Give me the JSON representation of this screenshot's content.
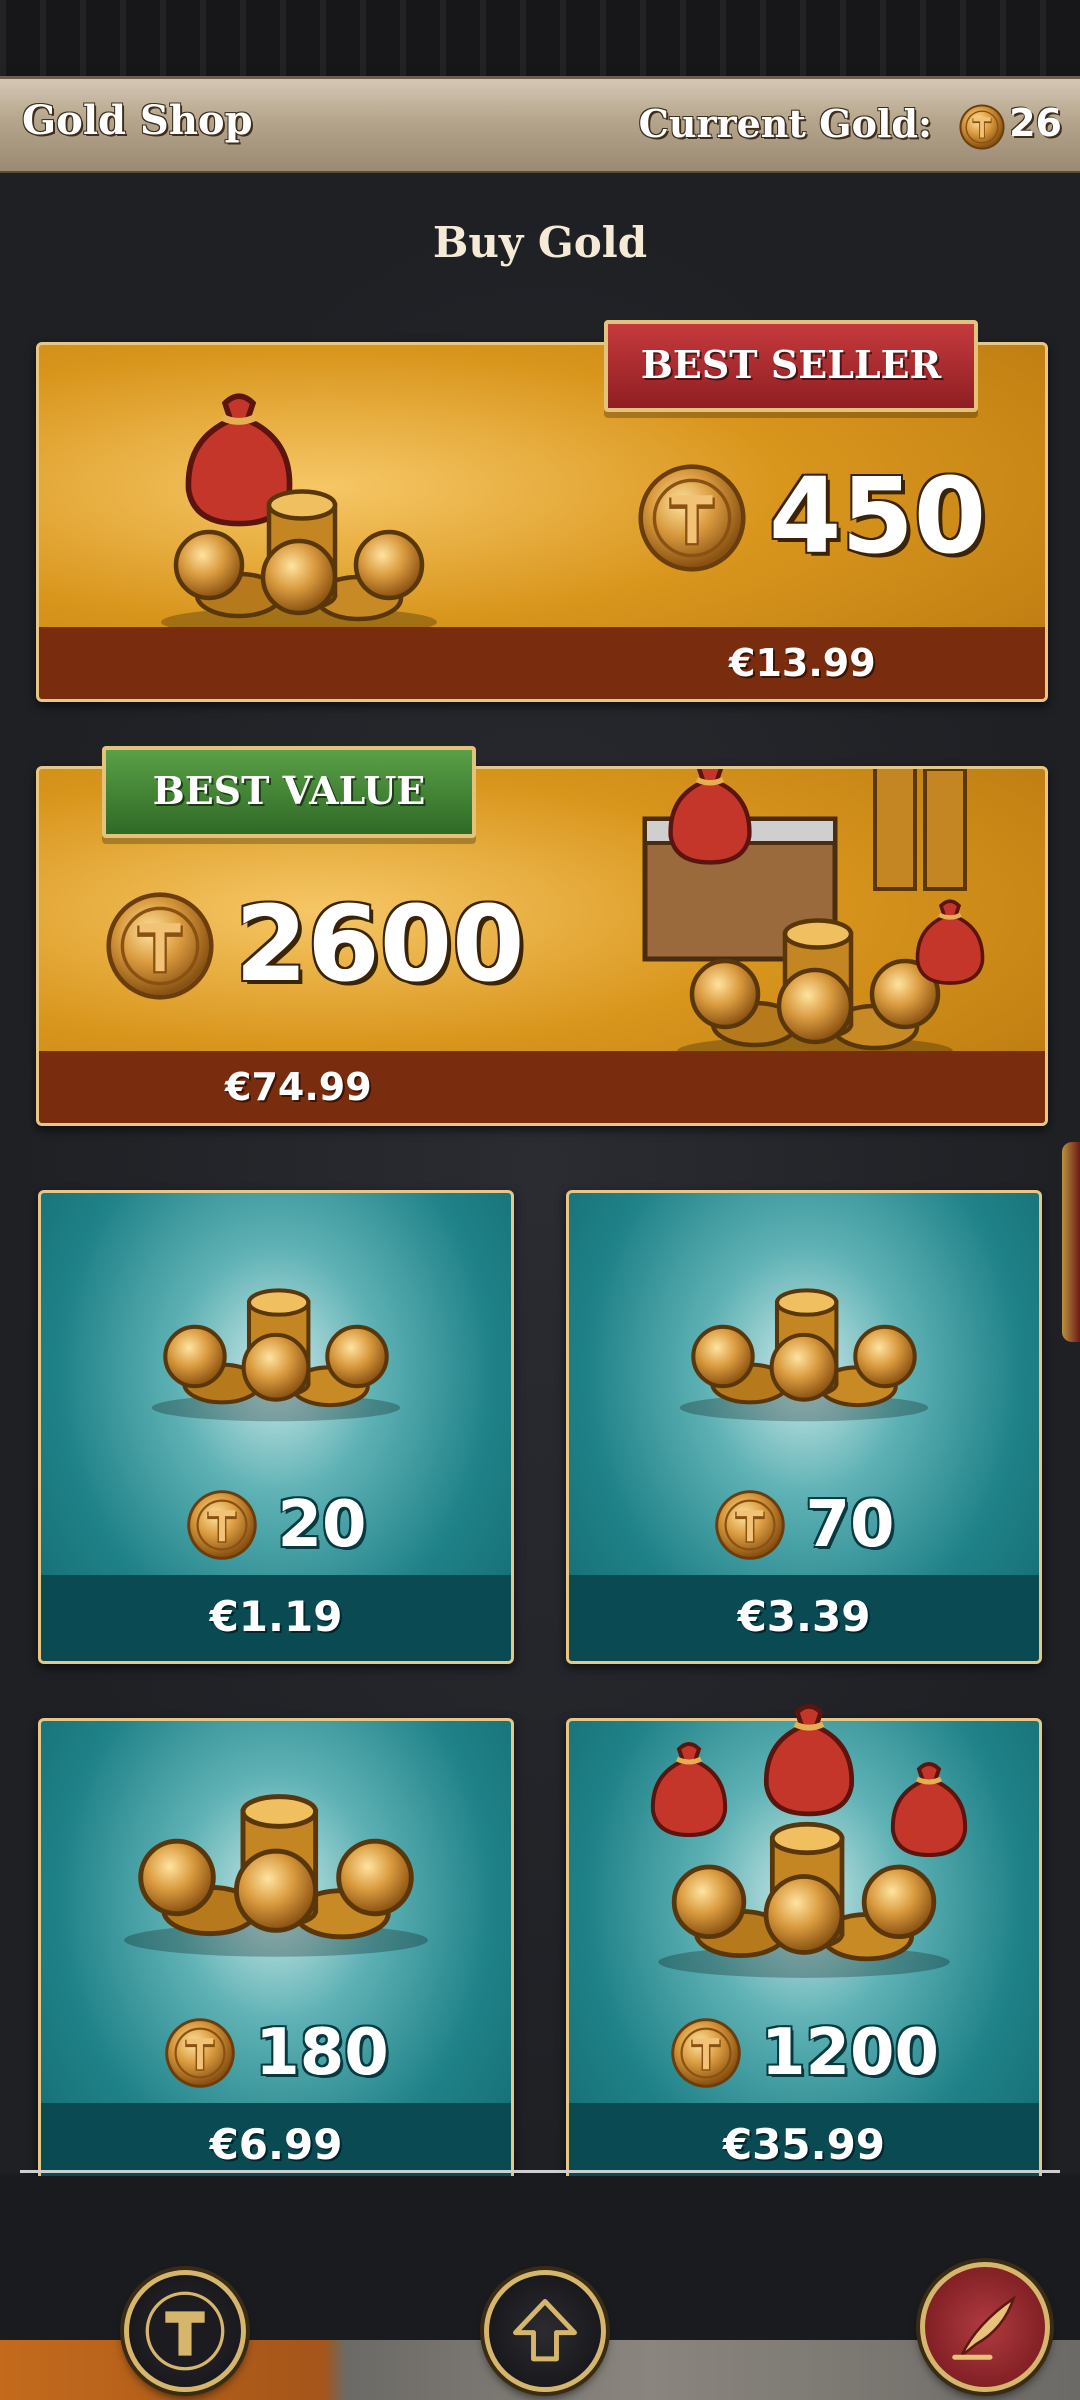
{
  "header": {
    "title": "Gold Shop",
    "gold_label": "Current Gold:",
    "gold_value": "26"
  },
  "section_title": "Buy Gold",
  "featured": [
    {
      "ribbon": "BEST SELLER",
      "amount": "450",
      "price": "€13.99"
    },
    {
      "ribbon": "BEST VALUE",
      "amount": "2600",
      "price": "€74.99"
    }
  ],
  "packs": [
    {
      "amount": "20",
      "price": "€1.19"
    },
    {
      "amount": "70",
      "price": "€3.39"
    },
    {
      "amount": "180",
      "price": "€6.99"
    },
    {
      "amount": "1200",
      "price": "€35.99"
    }
  ],
  "icons": {
    "coin": "gold-coin-icon",
    "nav_left": "gold-coin-nav-icon",
    "nav_center": "upgrade-arrow-icon",
    "nav_right": "quill-icon"
  },
  "colors": {
    "featured_bg": "#d9961d",
    "featured_bar": "#7a2d0e",
    "pack_bg": "#1f8288",
    "pack_bar": "#0a4a52",
    "best_seller": "#c53a3d",
    "best_value": "#5aa046",
    "frame": "#e6c785"
  }
}
